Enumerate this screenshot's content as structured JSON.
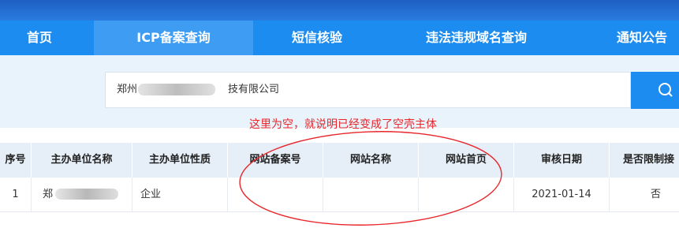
{
  "nav": {
    "items": [
      {
        "label": "首页"
      },
      {
        "label": "ICP备案查询"
      },
      {
        "label": "短信核验"
      },
      {
        "label": "违法违规域名查询"
      },
      {
        "label": "通知公告"
      }
    ],
    "active_index": 1
  },
  "search": {
    "value": "郑州",
    "value_suffix": "技有限公司",
    "button_icon": "search-icon"
  },
  "annotation": {
    "text": "这里为空，就说明已经变成了空壳主体",
    "color": "#e8262b"
  },
  "table": {
    "headers": [
      "序号",
      "主办单位名称",
      "主办单位性质",
      "网站备案号",
      "网站名称",
      "网站首页",
      "审核日期",
      "是否限制接"
    ],
    "rows": [
      {
        "index": "1",
        "name": "郑",
        "name_suffix": "…",
        "nature": "企业",
        "record_no": "",
        "site_name": "",
        "homepage": "",
        "date": "2021-01-14",
        "restricted": "否"
      }
    ]
  },
  "colors": {
    "nav_bg": "#1d8cf0",
    "nav_active_bg": "#3f9cf3",
    "search_band_bg": "#e9f3fb",
    "table_header_bg": "#e6eef7"
  }
}
